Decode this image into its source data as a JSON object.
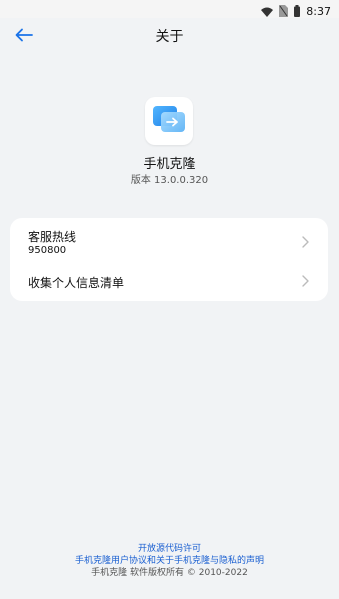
{
  "status_bar": {
    "time": "8:37",
    "icons": [
      "wifi-icon",
      "sim-card-icon",
      "battery-icon"
    ]
  },
  "header": {
    "title": "关于",
    "back_icon": "arrow-left-icon"
  },
  "app": {
    "icon": "phone-clone-app-icon",
    "name": "手机克隆",
    "version": "版本  13.0.0.320"
  },
  "list": {
    "items": [
      {
        "title": "客服热线",
        "subtitle": "950800",
        "icon": "chevron-right-icon"
      },
      {
        "title": "收集个人信息清单",
        "icon": "chevron-right-icon"
      }
    ]
  },
  "footer": {
    "open_source_link": "开放源代码许可",
    "agreement_link": "手机克隆用户协议和关于手机克隆与隐私的声明",
    "copyright": "手机克隆  软件版权所有 © 2010-2022"
  },
  "colors": {
    "accent": "#1a73e8",
    "link": "#1a5fd1",
    "background": "#f1f3f5",
    "card": "#ffffff"
  }
}
